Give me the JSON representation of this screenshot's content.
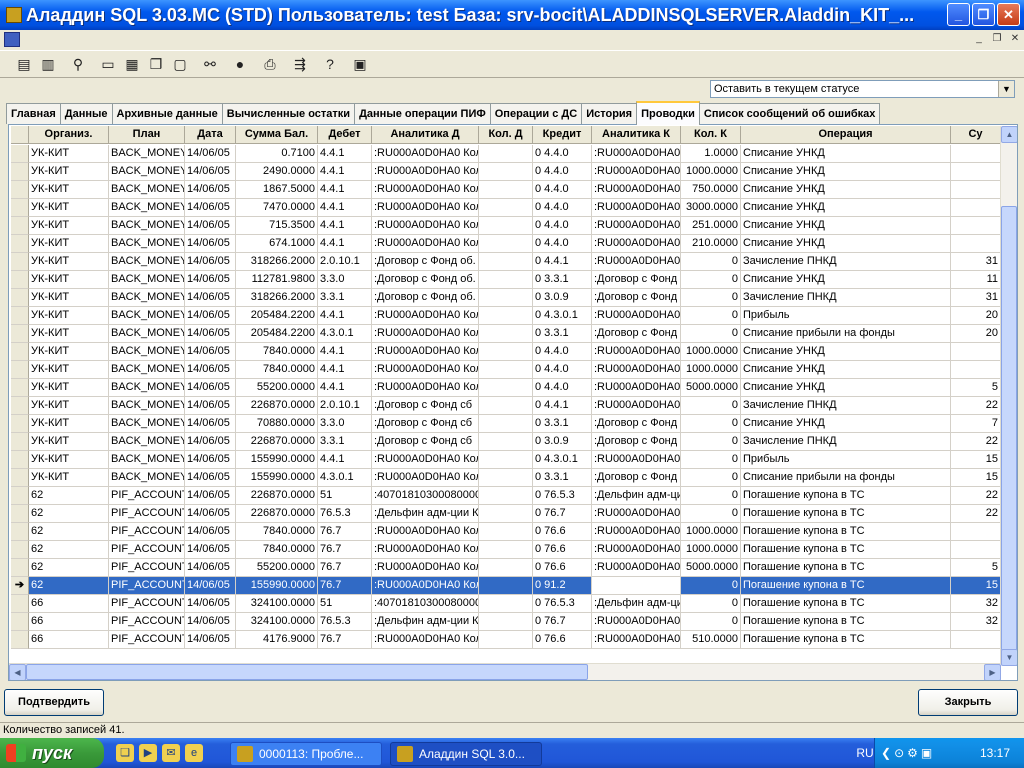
{
  "window": {
    "title": "Аладдин SQL 3.03.MC (STD)  Пользователь: test База: srv-bocit\\ALADDINSQLSERVER.Aladdin_KIT_...",
    "min_icon": "minimize-icon",
    "max_icon": "maximize-icon",
    "close_icon": "close-icon"
  },
  "mdi": {
    "min": "_",
    "restore": "❐",
    "close": "✕"
  },
  "toolbar": {
    "icons": [
      "list-icon",
      "database-icon",
      "filter-icon",
      "window-icon",
      "tile-icon",
      "cascade-icon",
      "blank-window-icon",
      "binoculars-icon",
      "stop-icon",
      "printer-icon",
      "export-icon",
      "help-icon",
      "calculator-icon"
    ],
    "glyphs": [
      "▤",
      "▥",
      "⚲",
      "▭",
      "▦",
      "❐",
      "▢",
      "⚯",
      "●",
      "⎙",
      "⇶",
      "?",
      "▣"
    ]
  },
  "status_select": {
    "value": "Оставить в текущем статусе",
    "arrow": "▼"
  },
  "tabs": [
    "Главная",
    "Данные",
    "Архивные данные",
    "Вычисленные остатки",
    "Данные операции ПИФ",
    "Операции с ДС",
    "История",
    "Проводки",
    "Список сообщений об ошибках"
  ],
  "active_tab": 7,
  "grid": {
    "columns": [
      "",
      "Организ.",
      "План",
      "Дата",
      "Сумма Бал.",
      "Дебет",
      "Аналитика Д",
      "Кол. Д",
      "Кредит",
      "Аналитика К",
      "Кол. К",
      "Операция",
      "Су"
    ],
    "selected_row": 24,
    "selected_marker": "➔",
    "rows": [
      [
        "УК-КИТ",
        "BACK_MONEY",
        "14/06/05",
        "0.7100",
        "4.4.1",
        ":RU000A0D0HA0 Кол",
        "",
        "0 4.4.0",
        ":RU000A0D0HA0",
        "1.0000",
        "Списание УНКД",
        ""
      ],
      [
        "УК-КИТ",
        "BACK_MONEY",
        "14/06/05",
        "2490.0000",
        "4.4.1",
        ":RU000A0D0HA0 Кол",
        "",
        "0 4.4.0",
        ":RU000A0D0HA0",
        "1000.0000",
        "Списание УНКД",
        ""
      ],
      [
        "УК-КИТ",
        "BACK_MONEY",
        "14/06/05",
        "1867.5000",
        "4.4.1",
        ":RU000A0D0HA0 Кол",
        "",
        "0 4.4.0",
        ":RU000A0D0HA0",
        "750.0000",
        "Списание УНКД",
        ""
      ],
      [
        "УК-КИТ",
        "BACK_MONEY",
        "14/06/05",
        "7470.0000",
        "4.4.1",
        ":RU000A0D0HA0 Кол",
        "",
        "0 4.4.0",
        ":RU000A0D0HA0",
        "3000.0000",
        "Списание УНКД",
        ""
      ],
      [
        "УК-КИТ",
        "BACK_MONEY",
        "14/06/05",
        "715.3500",
        "4.4.1",
        ":RU000A0D0HA0 Кол",
        "",
        "0 4.4.0",
        ":RU000A0D0HA0",
        "251.0000",
        "Списание УНКД",
        ""
      ],
      [
        "УК-КИТ",
        "BACK_MONEY",
        "14/06/05",
        "674.1000",
        "4.4.1",
        ":RU000A0D0HA0 Кол",
        "",
        "0 4.4.0",
        ":RU000A0D0HA0",
        "210.0000",
        "Списание УНКД",
        ""
      ],
      [
        "УК-КИТ",
        "BACK_MONEY",
        "14/06/05",
        "318266.2000",
        "2.0.10.1",
        ":Договор с Фонд об.",
        "",
        "0 4.4.1",
        ":RU000A0D0HA0",
        "0",
        "Зачисление ПНКД",
        "31"
      ],
      [
        "УК-КИТ",
        "BACK_MONEY",
        "14/06/05",
        "112781.9800",
        "3.3.0",
        ":Договор с Фонд об.",
        "",
        "0 3.3.1",
        ":Договор с Фонд",
        "0",
        "Списание УНКД",
        "11"
      ],
      [
        "УК-КИТ",
        "BACK_MONEY",
        "14/06/05",
        "318266.2000",
        "3.3.1",
        ":Договор с Фонд об.",
        "",
        "0 3.0.9",
        ":Договор с Фонд",
        "0",
        "Зачисление ПНКД",
        "31"
      ],
      [
        "УК-КИТ",
        "BACK_MONEY",
        "14/06/05",
        "205484.2200",
        "4.4.1",
        ":RU000A0D0HA0 Кол",
        "",
        "0 4.3.0.1",
        ":RU000A0D0HA0",
        "0",
        "Прибыль",
        "20"
      ],
      [
        "УК-КИТ",
        "BACK_MONEY",
        "14/06/05",
        "205484.2200",
        "4.3.0.1",
        ":RU000A0D0HA0 Кол",
        "",
        "0 3.3.1",
        ":Договор с Фонд",
        "0",
        "Списание прибыли на фонды",
        "20"
      ],
      [
        "УК-КИТ",
        "BACK_MONEY",
        "14/06/05",
        "7840.0000",
        "4.4.1",
        ":RU000A0D0HA0 Кол",
        "",
        "0 4.4.0",
        ":RU000A0D0HA0",
        "1000.0000",
        "Списание УНКД",
        ""
      ],
      [
        "УК-КИТ",
        "BACK_MONEY",
        "14/06/05",
        "7840.0000",
        "4.4.1",
        ":RU000A0D0HA0 Кол",
        "",
        "0 4.4.0",
        ":RU000A0D0HA0",
        "1000.0000",
        "Списание УНКД",
        ""
      ],
      [
        "УК-КИТ",
        "BACK_MONEY",
        "14/06/05",
        "55200.0000",
        "4.4.1",
        ":RU000A0D0HA0 Кол",
        "",
        "0 4.4.0",
        ":RU000A0D0HA0",
        "5000.0000",
        "Списание УНКД",
        "5"
      ],
      [
        "УК-КИТ",
        "BACK_MONEY",
        "14/06/05",
        "226870.0000",
        "2.0.10.1",
        ":Договор с Фонд сб",
        "",
        "0 4.4.1",
        ":RU000A0D0HA0",
        "0",
        "Зачисление ПНКД",
        "22"
      ],
      [
        "УК-КИТ",
        "BACK_MONEY",
        "14/06/05",
        "70880.0000",
        "3.3.0",
        ":Договор с Фонд сб",
        "",
        "0 3.3.1",
        ":Договор с Фонд",
        "0",
        "Списание УНКД",
        "7"
      ],
      [
        "УК-КИТ",
        "BACK_MONEY",
        "14/06/05",
        "226870.0000",
        "3.3.1",
        ":Договор с Фонд сб",
        "",
        "0 3.0.9",
        ":Договор с Фонд",
        "0",
        "Зачисление ПНКД",
        "22"
      ],
      [
        "УК-КИТ",
        "BACK_MONEY",
        "14/06/05",
        "155990.0000",
        "4.4.1",
        ":RU000A0D0HA0 Кол",
        "",
        "0 4.3.0.1",
        ":RU000A0D0HA0",
        "0",
        "Прибыль",
        "15"
      ],
      [
        "УК-КИТ",
        "BACK_MONEY",
        "14/06/05",
        "155990.0000",
        "4.3.0.1",
        ":RU000A0D0HA0 Кол",
        "",
        "0 3.3.1",
        ":Договор с Фонд",
        "0",
        "Списание прибыли на фонды",
        "15"
      ],
      [
        "62",
        "PIF_ACCOUNT",
        "14/06/05",
        "226870.0000",
        "51",
        ":40701810300080000",
        "",
        "0 76.5.3",
        ":Дельфин адм-ции",
        "0",
        "Погашение купона в ТС",
        "22"
      ],
      [
        "62",
        "PIF_ACCOUNT",
        "14/06/05",
        "226870.0000",
        "76.5.3",
        ":Дельфин адм-ции Ко",
        "",
        "0 76.7",
        ":RU000A0D0HA0",
        "0",
        "Погашение купона в ТС",
        "22"
      ],
      [
        "62",
        "PIF_ACCOUNT",
        "14/06/05",
        "7840.0000",
        "76.7",
        ":RU000A0D0HA0 Кол",
        "",
        "0 76.6",
        ":RU000A0D0HA0",
        "1000.0000",
        "Погашение купона в ТС",
        ""
      ],
      [
        "62",
        "PIF_ACCOUNT",
        "14/06/05",
        "7840.0000",
        "76.7",
        ":RU000A0D0HA0 Кол",
        "",
        "0 76.6",
        ":RU000A0D0HA0",
        "1000.0000",
        "Погашение купона в ТС",
        ""
      ],
      [
        "62",
        "PIF_ACCOUNT",
        "14/06/05",
        "55200.0000",
        "76.7",
        ":RU000A0D0HA0 Кол",
        "",
        "0 76.6",
        ":RU000A0D0HA0",
        "5000.0000",
        "Погашение купона в ТС",
        "5"
      ],
      [
        "62",
        "PIF_ACCOUNT",
        "14/06/05",
        "155990.0000",
        "76.7",
        ":RU000A0D0HA0 Кол",
        "",
        "0 91.2",
        "",
        "0",
        "Погашение купона в ТС",
        "15"
      ],
      [
        "66",
        "PIF_ACCOUNT",
        "14/06/05",
        "324100.0000",
        "51",
        ":40701810300080000",
        "",
        "0 76.5.3",
        ":Дельфин адм-ции",
        "0",
        "Погашение купона в ТС",
        "32"
      ],
      [
        "66",
        "PIF_ACCOUNT",
        "14/06/05",
        "324100.0000",
        "76.5.3",
        ":Дельфин адм-ции Ко",
        "",
        "0 76.7",
        ":RU000A0D0HA0",
        "0",
        "Погашение купона в ТС",
        "32"
      ],
      [
        "66",
        "PIF_ACCOUNT",
        "14/06/05",
        "4176.9000",
        "76.7",
        ":RU000A0D0HA0 Кол",
        "",
        "0 76.6",
        ":RU000A0D0HA0",
        "510.0000",
        "Погашение купона в ТС",
        ""
      ]
    ],
    "scroll": {
      "up": "▲",
      "down": "▼",
      "left": "◀",
      "right": "▶"
    }
  },
  "buttons": {
    "confirm": "Подтвердить",
    "close": "Закрыть"
  },
  "statusbar": {
    "text": "Количество записей 41."
  },
  "taskbar": {
    "start": "пуск",
    "quick_launch": [
      "❏",
      "▶",
      "✉",
      "e"
    ],
    "tasks": [
      "0000113: Пробле...",
      "Аладдин SQL 3.0..."
    ],
    "lang": "RU",
    "tray_glyphs": [
      "❮",
      "⊙",
      "⚙",
      "▣"
    ],
    "clock": "13:17"
  }
}
